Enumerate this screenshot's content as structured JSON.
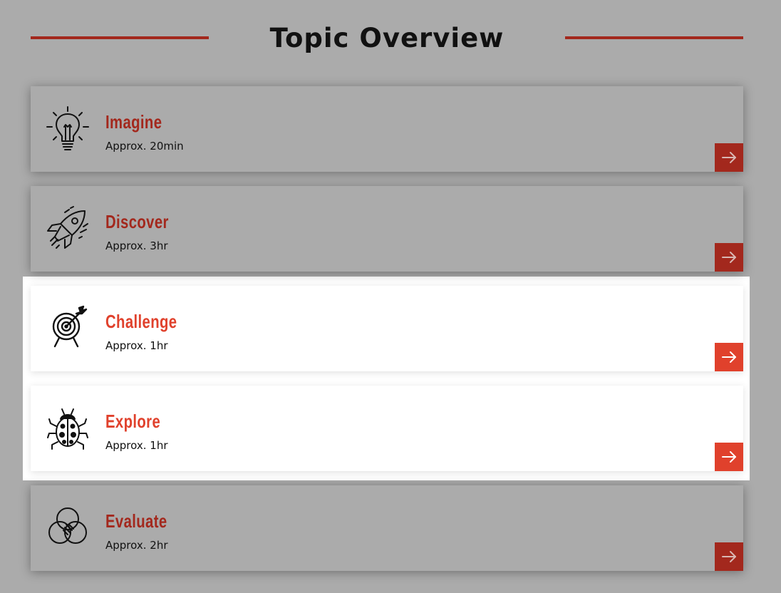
{
  "header": {
    "title": "Topic Overview"
  },
  "colors": {
    "page_background": "#ababab",
    "rule": "#a3281d",
    "accent_active": "#e0412c",
    "accent_dimmed": "#a3281d",
    "card_active_background": "#ffffff"
  },
  "cards": [
    {
      "name": "Imagine",
      "duration": "Approx. 20min",
      "icon": "lightbulb-icon",
      "active": false
    },
    {
      "name": "Discover",
      "duration": "Approx. 3hr",
      "icon": "rocket-icon",
      "active": false
    },
    {
      "name": "Challenge",
      "duration": "Approx. 1hr",
      "icon": "target-icon",
      "active": true
    },
    {
      "name": "Explore",
      "duration": "Approx. 1hr",
      "icon": "ladybug-icon",
      "active": true
    },
    {
      "name": "Evaluate",
      "duration": "Approx. 2hr",
      "icon": "venn-diagram-icon",
      "active": false
    }
  ]
}
